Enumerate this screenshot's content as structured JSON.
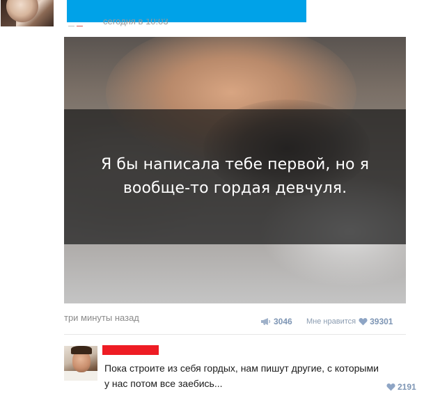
{
  "header": {
    "author_name_redacted": true,
    "timestamp": "сегодня в 10:03",
    "redaction_color": "#00a2e8"
  },
  "post": {
    "image_caption": "Я бы написала тебе первой, но я вообще-то гордая девчуля.",
    "posted_ago": "три минуты назад",
    "shares": "3046",
    "like_label": "Мне нравится",
    "likes": "39301",
    "icons": {
      "share": "megaphone-icon",
      "like": "heart-icon"
    }
  },
  "comment": {
    "author_name_redacted": true,
    "redaction_color": "#ee1c24",
    "text": "Пока строите из себя гордых, нам пишут другие, с которыми у нас потом все заебись...",
    "likes": "2191"
  },
  "colors": {
    "meta_link": "#7d95b4",
    "muted_text": "#8a8a8a"
  }
}
